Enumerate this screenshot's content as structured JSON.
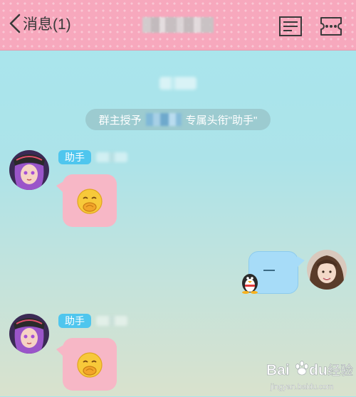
{
  "header": {
    "back_label": "消息(1)",
    "title": ""
  },
  "notice": {
    "prefix": "群主授予",
    "suffix": "专属头衔\"助手\""
  },
  "messages": [
    {
      "badge": "助手",
      "side": "left",
      "content": "emoji-face-icon"
    },
    {
      "side": "right",
      "content": "—"
    },
    {
      "badge": "助手",
      "side": "left",
      "content": "emoji-face-icon"
    }
  ],
  "watermark": {
    "logo_text": "Bai",
    "logo_text2": "du",
    "suffix": "经验",
    "url": "jingyan.baidu.com"
  },
  "colors": {
    "header_bg": "#f7a8bd",
    "badge_bg": "#4fc6ee",
    "bubble_pink": "#f7b7c6",
    "bubble_blue": "#a7dcf8"
  }
}
